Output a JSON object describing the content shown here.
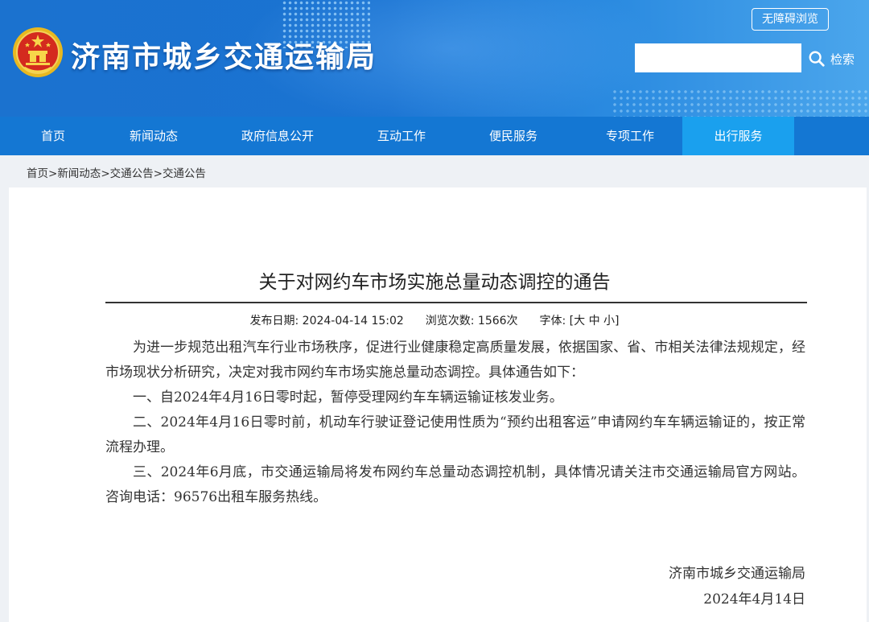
{
  "header": {
    "site_title": "济南市城乡交通运输局",
    "accessibility_label": "无障碍浏览",
    "search_placeholder": "",
    "search_label": "检索"
  },
  "nav": {
    "items": [
      {
        "label": "首页"
      },
      {
        "label": "新闻动态"
      },
      {
        "label": "政府信息公开"
      },
      {
        "label": "互动工作"
      },
      {
        "label": "便民服务"
      },
      {
        "label": "专项工作"
      },
      {
        "label": "出行服务"
      }
    ],
    "active_index": 6
  },
  "breadcrumb": {
    "items": [
      "首页",
      "新闻动态",
      "交通公告",
      "交通公告"
    ],
    "separator": ">"
  },
  "article": {
    "title": "关于对网约车市场实施总量动态调控的通告",
    "meta": {
      "date_label": "发布日期:",
      "date": "2024-04-14  15:02",
      "views_label": "浏览次数:",
      "views": "1566次",
      "font_label": "字体:",
      "font_open": "[",
      "font_large": "大",
      "font_medium": "中",
      "font_small": "小",
      "font_close": "]"
    },
    "paragraphs": [
      "为进一步规范出租汽车行业市场秩序，促进行业健康稳定高质量发展，依据国家、省、市相关法律法规规定，经市场现状分析研究，决定对我市网约车市场实施总量动态调控。具体通告如下：",
      "一、自2024年4月16日零时起，暂停受理网约车车辆运输证核发业务。",
      "二、2024年4月16日零时前，机动车行驶证登记使用性质为“预约出租客运”申请网约车车辆运输证的，按正常流程办理。",
      "三、2024年6月底，市交通运输局将发布网约车总量动态调控机制，具体情况请关注市交通运输局官方网站。咨询电话：96576出租车服务热线。"
    ],
    "signature": "济南市城乡交通运输局",
    "sign_date": "2024年4月14日"
  },
  "colors": {
    "nav_bg": "#1477d3",
    "nav_active": "#1aa0ee",
    "banner": "#1a73d2"
  },
  "icons": {
    "emblem": "national-emblem-icon",
    "search": "search-icon"
  }
}
